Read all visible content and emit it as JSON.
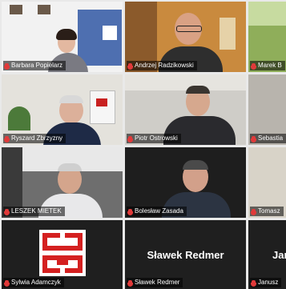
{
  "participants": [
    {
      "name": "Barbara Popielarz"
    },
    {
      "name": "Andrzej Radzikowski"
    },
    {
      "name": "Marek B"
    },
    {
      "name": "Ryszard Zbrzyzny"
    },
    {
      "name": "Piotr Ostrowski"
    },
    {
      "name": "Sebastia"
    },
    {
      "name": "LESZEK MIETEK"
    },
    {
      "name": "Bolesław Zasada"
    },
    {
      "name": "Tomasz"
    },
    {
      "name": "Sylwia Adamczyk"
    },
    {
      "name": "Sławek Redmer",
      "card_text": "Sławek Redmer"
    },
    {
      "name": "Janusz",
      "card_text": "Jan"
    }
  ],
  "colors": {
    "mic_muted": "#e03a3a",
    "logo_red": "#d42020"
  }
}
